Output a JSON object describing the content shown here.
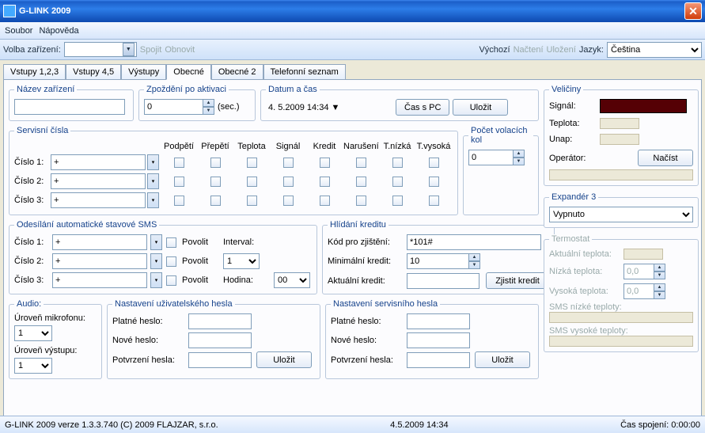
{
  "window": {
    "title": "G-LINK 2009"
  },
  "menu": {
    "file": "Soubor",
    "help": "Nápověda"
  },
  "toolbar": {
    "volba": "Volba zařízení:",
    "spojit": "Spojit",
    "obnovit": "Obnovit",
    "vychozi": "Výchozí",
    "nacteni": "Načtení",
    "ulozeni": "Uložení",
    "jazyk": "Jazyk:",
    "jazyk_val": "Čeština"
  },
  "tabs": [
    "Vstupy 1,2,3",
    "Vstupy 4,5",
    "Výstupy",
    "Obecné",
    "Obecné 2",
    "Telefonní seznam"
  ],
  "active_tab": 3,
  "nazev": {
    "legend": "Název zařízení",
    "value": ""
  },
  "zpozdeni": {
    "legend": "Zpoždění po aktivaci",
    "value": "0",
    "unit": "(sec.)"
  },
  "datum": {
    "legend": "Datum a čas",
    "value": "4. 5.2009  14:34",
    "cas_pc": "Čas s PC",
    "ulozit": "Uložit"
  },
  "serv": {
    "legend": "Servisní čísla",
    "headers": [
      "Podpětí",
      "Přepětí",
      "Teplota",
      "Signál",
      "Kredit",
      "Narušení",
      "T.nízká",
      "T.vysoká"
    ],
    "rows": [
      {
        "label": "Číslo 1:",
        "value": "+"
      },
      {
        "label": "Číslo 2:",
        "value": "+"
      },
      {
        "label": "Číslo 3:",
        "value": "+"
      }
    ]
  },
  "pocet": {
    "legend": "Počet volacích kol",
    "value": "0"
  },
  "sms": {
    "legend": "Odesílání automatické stavové SMS",
    "povolit": "Povolit",
    "interval": "Interval:",
    "interval_val": "1",
    "hodina": "Hodina:",
    "hodina_val": "00",
    "rows": [
      {
        "label": "Číslo 1:",
        "value": "+"
      },
      {
        "label": "Číslo 2:",
        "value": "+"
      },
      {
        "label": "Číslo 3:",
        "value": "+"
      }
    ]
  },
  "kredit": {
    "legend": "Hlídání kreditu",
    "kod_lbl": "Kód pro zjištění:",
    "kod_val": "*101#",
    "min_lbl": "Minimální kredit:",
    "min_val": "10",
    "akt_lbl": "Aktuální kredit:",
    "btn": "Zjistit kredit"
  },
  "audio": {
    "legend": "Audio:",
    "mic": "Úroveň mikrofonu:",
    "mic_val": "1",
    "out": "Úroveň výstupu:",
    "out_val": "1"
  },
  "uheslo": {
    "legend": "Nastavení uživatelského hesla",
    "platne": "Platné heslo:",
    "nove": "Nové heslo:",
    "potvrz": "Potvrzení hesla:",
    "btn": "Uložit"
  },
  "sheslo": {
    "legend": "Nastavení servisního hesla",
    "platne": "Platné heslo:",
    "nove": "Nové heslo:",
    "potvrz": "Potvrzení hesla:",
    "btn": "Uložit"
  },
  "veliciny": {
    "legend": "Veličiny",
    "signal": "Signál:",
    "teplota": "Teplota:",
    "unap": "Unap:",
    "op": "Operátor:",
    "btn": "Načíst"
  },
  "expander": {
    "legend": "Expandér 3",
    "value": "Vypnuto"
  },
  "termostat": {
    "legend": "Termostat",
    "akt": "Aktuální teplota:",
    "nizka": "Nízká teplota:",
    "nizka_val": "0,0",
    "vysoka": "Vysoká teplota:",
    "vysoka_val": "0,0",
    "sms_nizke": "SMS nízké teploty:",
    "sms_vysoke": "SMS vysoké teploty:"
  },
  "status": {
    "ver": "G-LINK 2009 verze 1.3.3.740   (C) 2009 FLAJZAR, s.r.o.",
    "dt": "4.5.2009  14:34",
    "spoj": "Čas spojení: 0:00:00"
  }
}
